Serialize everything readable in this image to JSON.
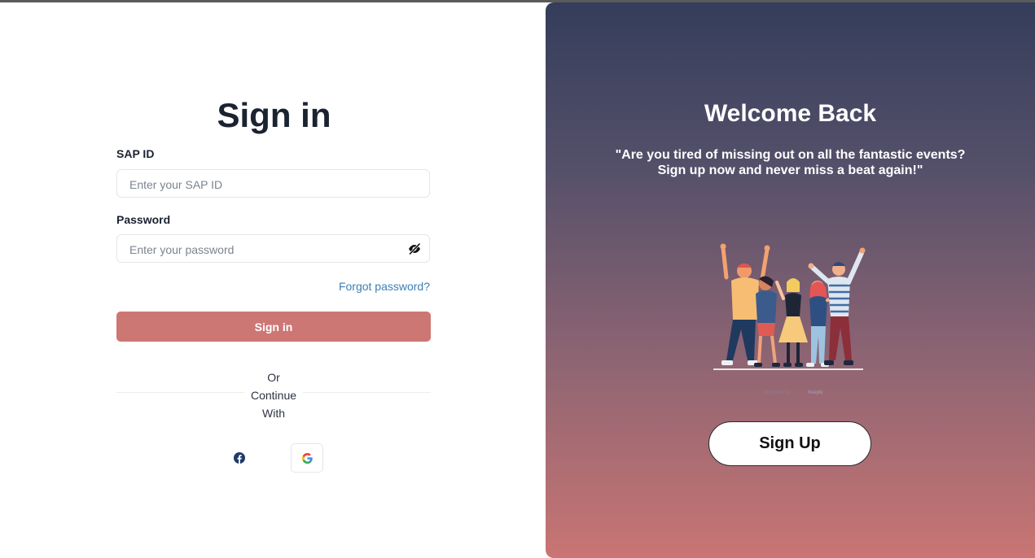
{
  "signin": {
    "title": "Sign in",
    "sap_label": "SAP ID",
    "sap_placeholder": "Enter your SAP ID",
    "password_label": "Password",
    "password_placeholder": "Enter your password",
    "forgot": "Forgot password?",
    "button": "Sign in",
    "or_line1": "Or",
    "or_line2": "Continue",
    "or_line3": "With",
    "social": [
      {
        "name": "facebook",
        "icon": "facebook-icon"
      },
      {
        "name": "google",
        "icon": "google-icon"
      }
    ]
  },
  "welcome": {
    "title": "Welcome Back",
    "quote_line1": "\"Are you tired of missing out on all the fantastic events?",
    "quote_line2": "Sign up now and never miss a beat again!\"",
    "credit_dim": "designed by",
    "credit": "freepik",
    "button": "Sign Up"
  },
  "colors": {
    "primary_button": "#cd7774",
    "link": "#3d7eb5",
    "panel_top": "#343d5b",
    "panel_bottom": "#c97573"
  }
}
